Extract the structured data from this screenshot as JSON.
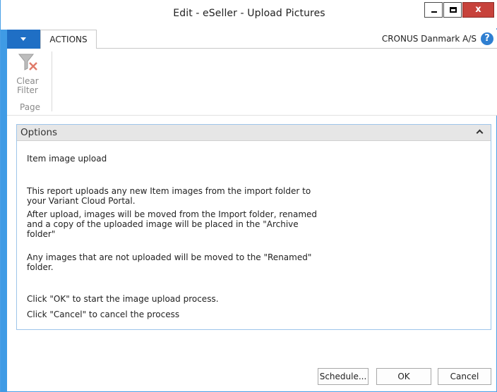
{
  "window": {
    "title": "Edit - eSeller - Upload Pictures",
    "close_glyph": "x"
  },
  "ribbon": {
    "tab_label": "ACTIONS",
    "company": "CRONUS Danmark A/S",
    "help_glyph": "?",
    "clear_filter_line1": "Clear",
    "clear_filter_line2": "Filter",
    "group_label": "Page"
  },
  "options": {
    "header": "Options",
    "paragraphs": [
      "Item image upload",
      "This report uploads any new Item images from the import folder to your Variant Cloud Portal.",
      "After upload, images will be moved from the Import folder, renamed and a copy of the uploaded image will be placed in the \"Archive folder\"",
      "Any images that are not uploaded will be moved to the \"Renamed\" folder.",
      "Click \"OK\" to start the image upload process.",
      "Click \"Cancel\" to cancel the process"
    ]
  },
  "buttons": {
    "schedule": "Schedule...",
    "ok": "OK",
    "cancel": "Cancel"
  },
  "colors": {
    "accent": "#1f6fc5",
    "frame": "#3f9be5",
    "close": "#c7423b"
  }
}
